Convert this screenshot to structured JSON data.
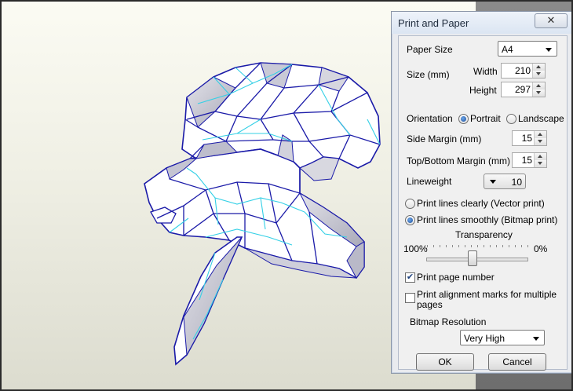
{
  "dialog": {
    "title": "Print and Paper",
    "close_label": "✕",
    "paper_size": {
      "label": "Paper Size",
      "value": "A4"
    },
    "size": {
      "label": "Size (mm)",
      "width_label": "Width",
      "width_value": "210",
      "height_label": "Height",
      "height_value": "297"
    },
    "orientation": {
      "label": "Orientation",
      "options": [
        "Portrait",
        "Landscape"
      ],
      "selected": "Portrait"
    },
    "side_margin": {
      "label": "Side Margin (mm)",
      "value": "15"
    },
    "topbottom_margin": {
      "label": "Top/Bottom Margin (mm)",
      "value": "15"
    },
    "lineweight": {
      "label": "Lineweight",
      "value": "10"
    },
    "print_mode": {
      "options": [
        "Print lines clearly (Vector print)",
        "Print lines smoothly (Bitmap print)"
      ],
      "selected": "Print lines smoothly (Bitmap print)"
    },
    "transparency": {
      "label": "Transparency",
      "min_label": "100%",
      "max_label": "0%",
      "level": 0.45
    },
    "print_page_number": {
      "label": "Print page number",
      "checked": true
    },
    "alignment_marks": {
      "label_line1": "Print alignment marks for multiple",
      "label_line2": "pages",
      "checked": false
    },
    "bitmap_resolution": {
      "label": "Bitmap Resolution",
      "value": "Very High"
    },
    "ok_label": "OK",
    "cancel_label": "Cancel"
  },
  "model": {
    "icon": "lowpoly-model",
    "edge_color": "#1a1aa8",
    "fold_color": "#34d0e6",
    "face_color": "#ffffff",
    "shade_color": "#c9c9d6"
  }
}
